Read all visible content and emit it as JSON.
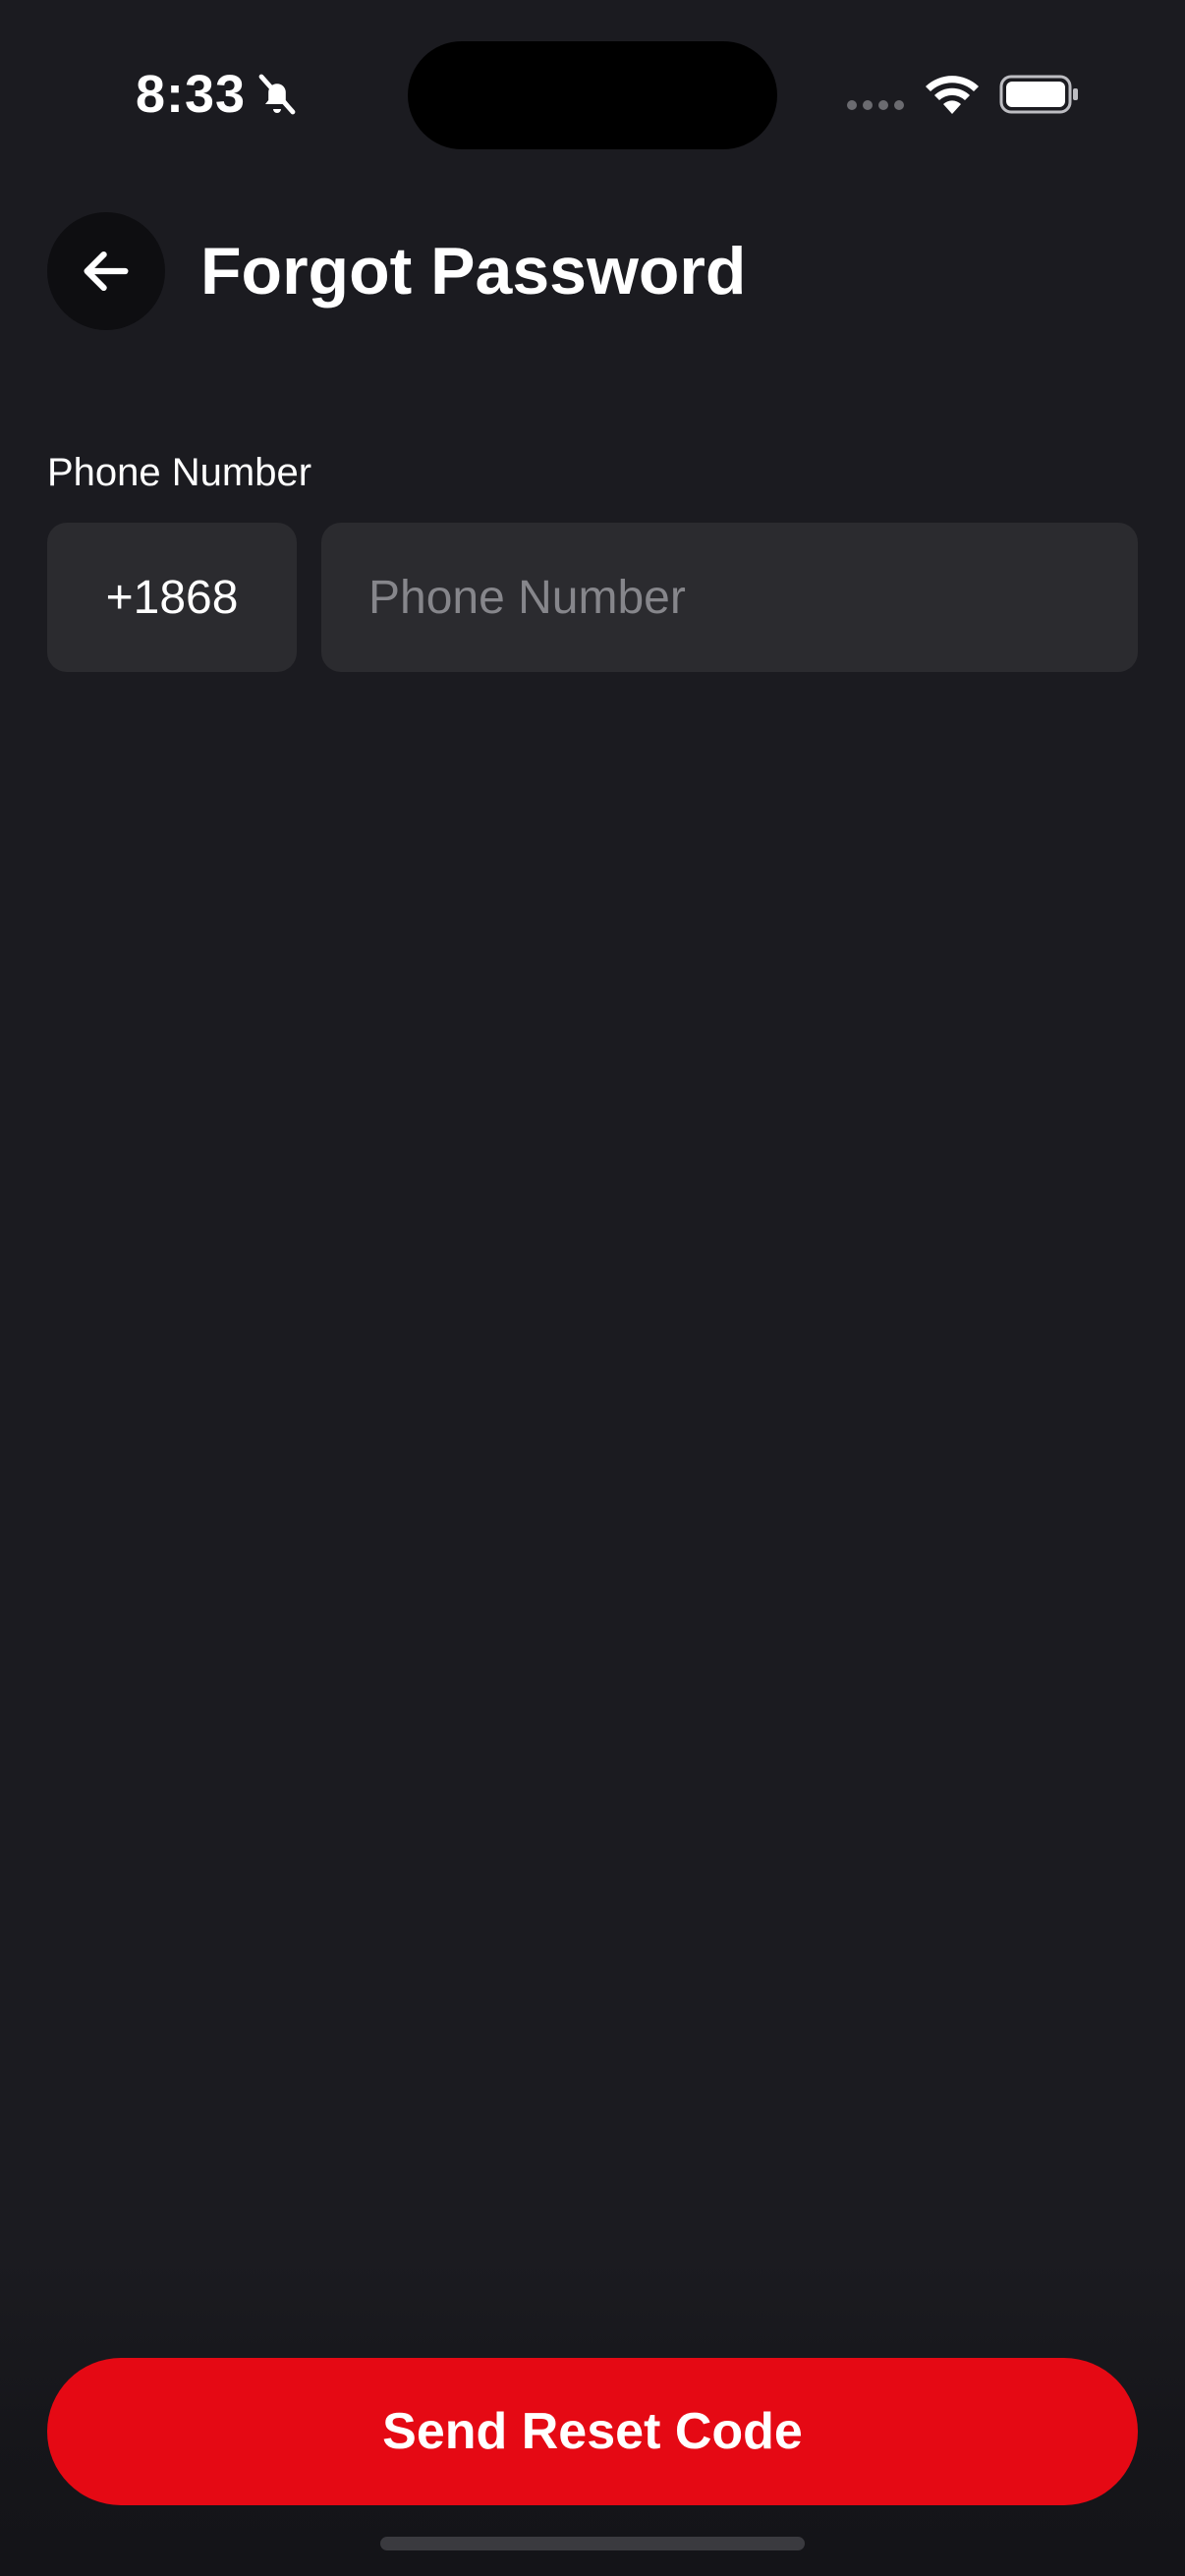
{
  "status_bar": {
    "time": "8:33",
    "icons": {
      "notifications": "bell-slash-icon",
      "signal": "cellular-signal-icon",
      "wifi": "wifi-icon",
      "battery": "battery-full-icon"
    }
  },
  "header": {
    "back_icon": "arrow-left-icon",
    "title": "Forgot Password"
  },
  "form": {
    "phone_label": "Phone Number",
    "country_code": "+1868",
    "phone_value": "",
    "phone_placeholder": "Phone Number"
  },
  "actions": {
    "submit_label": "Send Reset Code"
  },
  "colors": {
    "background": "#1b1b20",
    "input_background": "#2b2b2f",
    "accent": "#e50914",
    "placeholder": "#86868b"
  }
}
